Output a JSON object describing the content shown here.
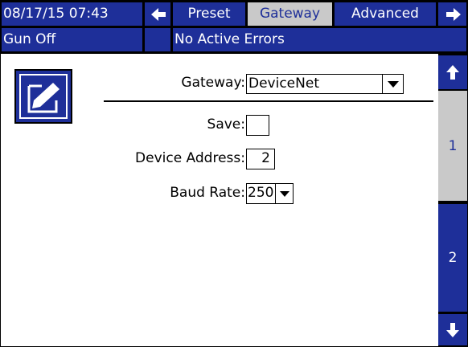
{
  "status_bar": {
    "datetime": "08/17/15 07:43",
    "tabs": [
      "Preset",
      "Gateway",
      "Advanced"
    ],
    "active_tab": "Gateway",
    "gun_status": "Gun Off",
    "error_status": "No Active Errors"
  },
  "form": {
    "gateway_label": "Gateway:",
    "gateway_value": "DeviceNet",
    "save_label": "Save:",
    "device_address_label": "Device Address:",
    "device_address_value": "2",
    "baud_rate_label": "Baud Rate:",
    "baud_rate_value": "250"
  },
  "pager": {
    "pages": [
      "1",
      "2"
    ],
    "active_page": "1"
  },
  "colors": {
    "accent_blue": "#1e2f99",
    "active_gray": "#c9c9c9",
    "background": "#ffffff"
  },
  "icons": [
    "arrow-left-icon",
    "arrow-right-icon",
    "edit-icon",
    "arrow-up-icon",
    "arrow-down-icon",
    "dropdown-arrow-icon"
  ]
}
